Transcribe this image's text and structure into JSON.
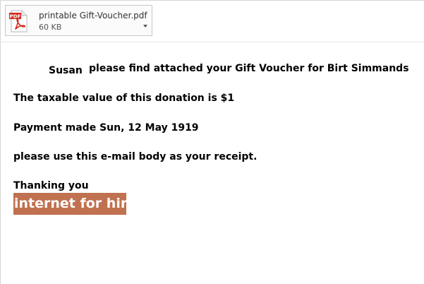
{
  "attachment": {
    "file_name": "printable Gift-Voucher.pdf",
    "file_size": "60 KB",
    "icon": "pdf-file-icon",
    "icon_badge": "PDF",
    "menu_icon": "chevron-down-icon"
  },
  "message": {
    "recipient_name": "Susan",
    "greeting": "please find attached your Gift Voucher for Birt Simmands",
    "taxable_line": "The taxable value of this donation is $1",
    "payment_line": "Payment made Sun, 12 May 1919",
    "receipt_line": "please use this e-mail body as your receipt.",
    "closing": "Thanking you",
    "signature": "internet for hire"
  },
  "colors": {
    "signature_background": "#c0714f",
    "signature_text": "#ffffff",
    "pdf_red": "#d4271d"
  }
}
